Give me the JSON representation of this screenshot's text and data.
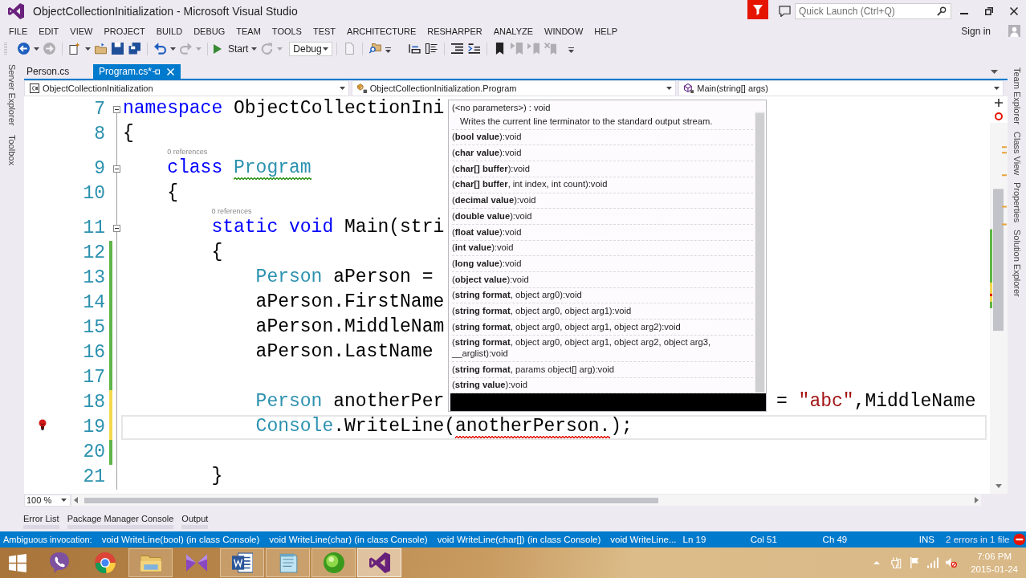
{
  "window": {
    "title": "ObjectCollectionInitialization - Microsoft Visual Studio"
  },
  "title_bar": {
    "quick_launch": {
      "placeholder": "Quick Launch (Ctrl+Q)"
    }
  },
  "menu": [
    "FILE",
    "EDIT",
    "VIEW",
    "PROJECT",
    "BUILD",
    "DEBUG",
    "TEAM",
    "TOOLS",
    "TEST",
    "ARCHITECTURE",
    "RESHARPER",
    "ANALYZE",
    "WINDOW",
    "HELP"
  ],
  "account": {
    "label": "Sign in"
  },
  "toolbar": {
    "back": {
      "disabled": false
    },
    "forward": {
      "disabled": true
    },
    "undo": {
      "disabled": false
    },
    "redo": {
      "disabled": true
    },
    "start": {
      "label": "Start"
    },
    "restart": {
      "disabled": true
    },
    "configuration": {
      "value": "Debug"
    },
    "bookmark_previous": {
      "disabled": true
    },
    "bookmark_next": {
      "disabled": true
    },
    "bookmark_clear": {
      "disabled": true
    }
  },
  "left_tool_strip": [
    "Server Explorer",
    "Toolbox"
  ],
  "right_tool_strip": [
    "Team Explorer",
    "Class View",
    "Properties",
    "Solution Explorer"
  ],
  "document_tabs": [
    {
      "label": "Person.cs",
      "selected": false
    },
    {
      "label": "Program.cs*",
      "selected": true
    }
  ],
  "navigation_bar": [
    "ObjectCollectionInitialization",
    "ObjectCollectionInitialization.Program",
    "Main(string[] args)"
  ],
  "editor": {
    "zoom": "100 %",
    "lines": [
      {
        "number": "7",
        "foldable": true,
        "current": false,
        "quick_fix": false,
        "code": [
          {
            "kind": "keyword",
            "text": "namespace"
          },
          {
            "kind": "plain",
            "text": " ObjectCollectionIni"
          }
        ]
      },
      {
        "number": "8",
        "foldable": false,
        "current": false,
        "quick_fix": false,
        "code": [
          {
            "kind": "plain",
            "text": "{"
          }
        ],
        "children": [
          {
            "number": "9",
            "foldable": true,
            "current": false,
            "quick_fix": false,
            "references": "0 references",
            "code": [
              {
                "kind": "keyword",
                "text": "class "
              },
              {
                "kind": "type",
                "text": "Program",
                "squiggle": {
                  "color": "#3c9a28"
                }
              }
            ]
          },
          {
            "number": "10",
            "foldable": false,
            "current": false,
            "quick_fix": false,
            "code": [
              {
                "kind": "plain",
                "text": "{"
              }
            ],
            "children": [
              {
                "number": "11",
                "foldable": true,
                "current": false,
                "quick_fix": false,
                "references": "0 references",
                "code": [
                  {
                    "kind": "keyword",
                    "text": "static void"
                  },
                  {
                    "kind": "plain",
                    "text": " Main(stri"
                  }
                ]
              },
              {
                "number": "12",
                "foldable": false,
                "current": false,
                "quick_fix": false,
                "change_marker": {
                  "color": "#5fb646"
                },
                "code": [
                  {
                    "kind": "plain",
                    "text": "{"
                  }
                ],
                "children": [
                  {
                    "number": "13",
                    "foldable": false,
                    "current": false,
                    "quick_fix": false,
                    "change_marker": {
                      "color": "#5fb646"
                    },
                    "code": [
                      {
                        "kind": "type",
                        "text": "Person"
                      },
                      {
                        "kind": "plain",
                        "text": " aPerson ="
                      }
                    ]
                  },
                  {
                    "number": "14",
                    "foldable": false,
                    "current": false,
                    "quick_fix": false,
                    "change_marker": {
                      "color": "#5fb646"
                    },
                    "code": [
                      {
                        "kind": "plain",
                        "text": "aPerson.FirstName"
                      }
                    ]
                  },
                  {
                    "number": "15",
                    "foldable": false,
                    "current": false,
                    "quick_fix": false,
                    "change_marker": {
                      "color": "#5fb646"
                    },
                    "code": [
                      {
                        "kind": "plain",
                        "text": "aPerson.MiddleNam"
                      }
                    ]
                  },
                  {
                    "number": "16",
                    "foldable": false,
                    "current": false,
                    "quick_fix": false,
                    "change_marker": {
                      "color": "#5fb646"
                    },
                    "code": [
                      {
                        "kind": "plain",
                        "text": "aPerson.LastName"
                      }
                    ]
                  },
                  {
                    "number": "17",
                    "foldable": false,
                    "current": false,
                    "quick_fix": false,
                    "change_marker": {
                      "color": "#5fb646"
                    }
                  },
                  {
                    "number": "18",
                    "foldable": false,
                    "current": false,
                    "quick_fix": false,
                    "change_marker": {
                      "color": "#f2d94e"
                    },
                    "code": [
                      {
                        "kind": "type",
                        "text": "Person"
                      },
                      {
                        "kind": "plain",
                        "text": " anotherPer"
                      }
                    ],
                    "code_after_popup": [
                      {
                        "kind": "plain",
                        "text": "= "
                      },
                      {
                        "kind": "string",
                        "text": "\"abc\""
                      },
                      {
                        "kind": "plain",
                        "text": ",MiddleName"
                      }
                    ]
                  },
                  {
                    "number": "19",
                    "foldable": false,
                    "current": true,
                    "quick_fix": true,
                    "change_marker": {
                      "color": "#f2d94e"
                    },
                    "code": [
                      {
                        "kind": "type",
                        "text": "Console"
                      },
                      {
                        "kind": "plain",
                        "text": ".WriteLine("
                      },
                      {
                        "kind": "plain",
                        "text": "anotherPerson.",
                        "squiggle": {
                          "color": "#e51400"
                        }
                      },
                      {
                        "kind": "plain",
                        "text": ");"
                      }
                    ]
                  },
                  {
                    "number": "20",
                    "foldable": false,
                    "current": false,
                    "quick_fix": false,
                    "change_marker": {
                      "color": "#5fb646"
                    }
                  }
                ]
              },
              {
                "number": "21",
                "foldable": false,
                "current": false,
                "quick_fix": false,
                "code": [
                  {
                    "kind": "plain",
                    "text": "}"
                  }
                ]
              }
            ]
          }
        ]
      }
    ]
  },
  "parameter_info": {
    "overloads": [
      {
        "signature": "(<no parameters>) : void",
        "description": "Writes the current line terminator to the standard output stream."
      },
      {
        "signature": "(**bool value**):void"
      },
      {
        "signature": "(**char value**):void"
      },
      {
        "signature": "(**char[] buffer**):void"
      },
      {
        "signature": "(**char[] buffer**, int index, int count):void"
      },
      {
        "signature": "(**decimal value**):void"
      },
      {
        "signature": "(**double value**):void"
      },
      {
        "signature": "(**float value**):void"
      },
      {
        "signature": "(**int value**):void"
      },
      {
        "signature": "(**long value**):void"
      },
      {
        "signature": "(**object value**):void"
      },
      {
        "signature": "(**string format**, object arg0):void"
      },
      {
        "signature": "(**string format**, object arg0, object arg1):void"
      },
      {
        "signature": "(**string format**, object arg0, object arg1, object arg2):void"
      },
      {
        "signature": "(**string format**, object arg0, object arg1, object arg2, object arg3, __arglist):void"
      },
      {
        "signature": "(**string format**, params object[] arg):void"
      },
      {
        "signature": "(**string value**):void"
      }
    ]
  },
  "tool_tabs": [
    "Error List",
    "Package Manager Console",
    "Output"
  ],
  "status_bar": {
    "message": "Ambiguous invocation:",
    "candidates": [
      "void WriteLine(bool) (in class Console)",
      "void WriteLine(char) (in class Console)",
      "void WriteLine(char[]) (in class Console)",
      "void WriteLine..."
    ],
    "line": "Ln 19",
    "column": "Col 51",
    "character": "Ch 49",
    "mode": "INS",
    "errors": "2 errors in 1 file"
  },
  "taskbar": {
    "apps": [
      {
        "running": false,
        "active": false
      },
      {
        "running": false,
        "active": false
      },
      {
        "running": true,
        "active": false
      },
      {
        "running": false,
        "active": false
      },
      {
        "running": true,
        "active": false
      },
      {
        "running": true,
        "active": false
      },
      {
        "running": true,
        "active": false
      },
      {
        "running": true,
        "active": true
      }
    ],
    "time": "7:06 PM",
    "date": "2015-01-24"
  }
}
